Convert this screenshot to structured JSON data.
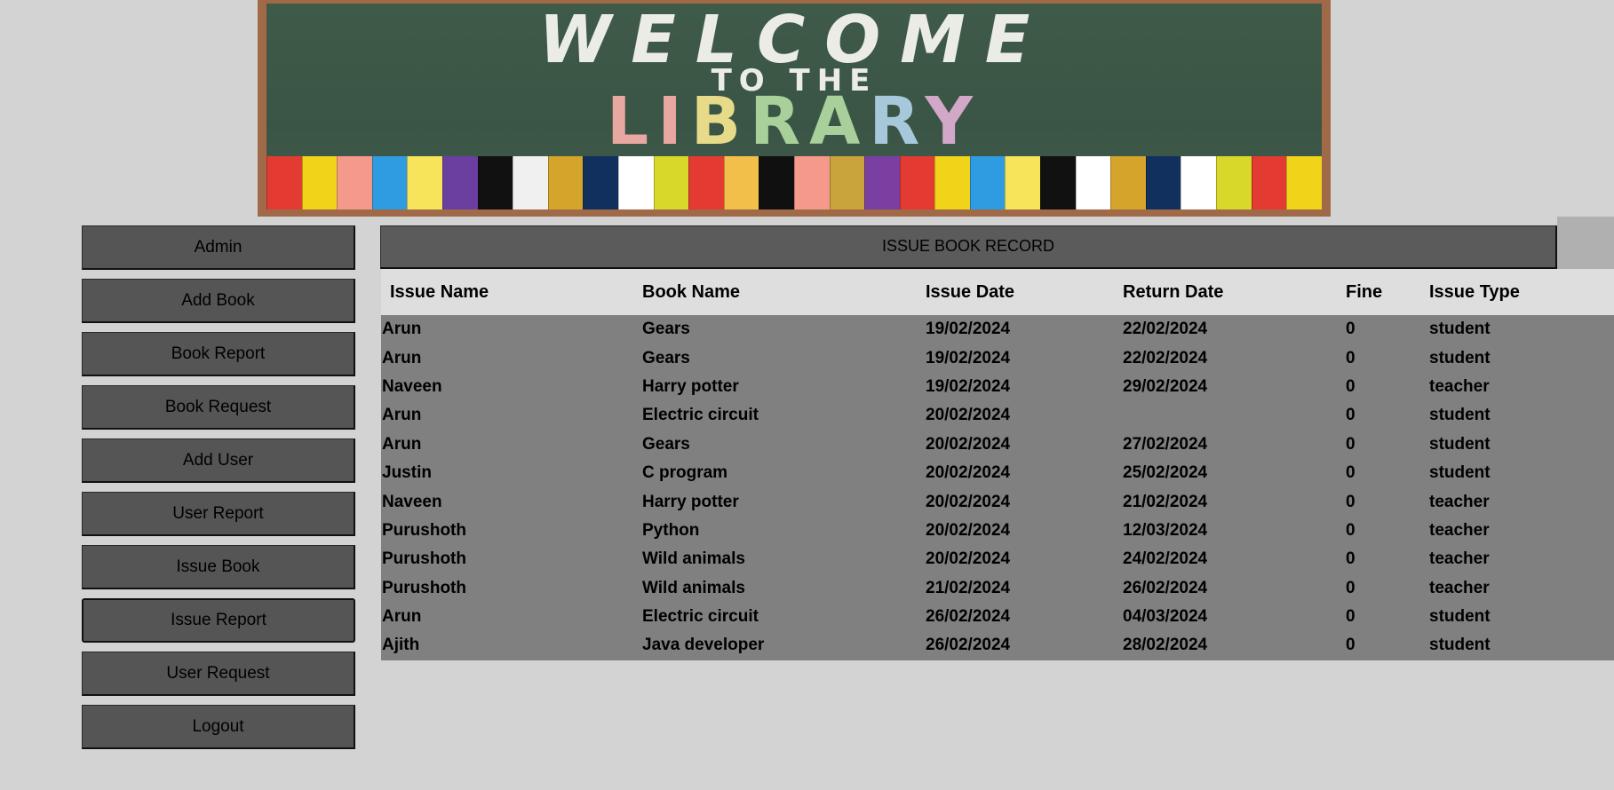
{
  "banner": {
    "welcome": "WELCOME",
    "to_the": "TO THE",
    "library_letters": [
      "L",
      "I",
      "B",
      "R",
      "A",
      "R",
      "Y"
    ],
    "book_colors": [
      "#e33b32",
      "#f1d31a",
      "#f59a8a",
      "#2f9be0",
      "#f7e45a",
      "#6a3fa0",
      "#111111",
      "#f0f0f0",
      "#d4a52a",
      "#12305e",
      "#ffffff",
      "#d8d82a",
      "#e33b32",
      "#f2c04a",
      "#101010",
      "#f59a8a",
      "#c9a43a",
      "#7a3fa0",
      "#e33b32",
      "#f1d31a",
      "#2f9be0",
      "#f7e45a",
      "#111111",
      "#ffffff",
      "#d4a52a",
      "#12305e",
      "#ffffff",
      "#d8d82a",
      "#e33b32",
      "#f1d31a"
    ]
  },
  "sidebar": {
    "items": [
      {
        "label": "Admin"
      },
      {
        "label": "Add Book"
      },
      {
        "label": "Book Report"
      },
      {
        "label": "Book Request"
      },
      {
        "label": "Add User"
      },
      {
        "label": "User Report"
      },
      {
        "label": "Issue Book"
      },
      {
        "label": "Issue Report"
      },
      {
        "label": "User Request"
      },
      {
        "label": "Logout"
      }
    ],
    "active": "Issue Report"
  },
  "main": {
    "title": "ISSUE BOOK RECORD",
    "columns": [
      "Issue Name",
      "Book Name",
      "Issue Date",
      "Return Date",
      "Fine",
      "Issue Type"
    ],
    "rows": [
      [
        "Arun",
        "Gears",
        "19/02/2024",
        "22/02/2024",
        "0",
        "student"
      ],
      [
        "Arun",
        "Gears",
        "19/02/2024",
        "22/02/2024",
        "0",
        "student"
      ],
      [
        "Naveen",
        "Harry potter",
        "19/02/2024",
        "29/02/2024",
        "0",
        "teacher"
      ],
      [
        "Arun",
        "Electric circuit",
        "20/02/2024",
        "",
        "0",
        "student"
      ],
      [
        "Arun",
        "Gears",
        "20/02/2024",
        "27/02/2024",
        "0",
        "student"
      ],
      [
        "Justin",
        "C program",
        "20/02/2024",
        "25/02/2024",
        "0",
        "student"
      ],
      [
        "Naveen",
        "Harry potter",
        "20/02/2024",
        "21/02/2024",
        "0",
        "teacher"
      ],
      [
        "Purushoth",
        "Python",
        "20/02/2024",
        "12/03/2024",
        "0",
        "teacher"
      ],
      [
        "Purushoth",
        "Wild animals",
        "20/02/2024",
        "24/02/2024",
        "0",
        "teacher"
      ],
      [
        "Purushoth",
        "Wild animals",
        "21/02/2024",
        "26/02/2024",
        "0",
        "teacher"
      ],
      [
        "Arun",
        "Electric circuit",
        "26/02/2024",
        "04/03/2024",
        "0",
        "student"
      ],
      [
        "Ajith",
        "Java developer",
        "26/02/2024",
        "28/02/2024",
        "0",
        "student"
      ]
    ]
  }
}
